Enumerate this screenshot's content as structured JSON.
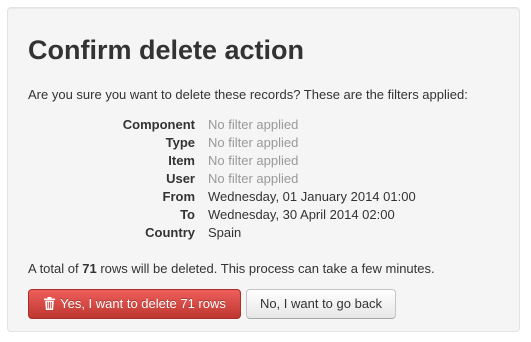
{
  "dialog": {
    "title": "Confirm delete action",
    "intro": "Are you sure you want to delete these records? These are the filters applied:"
  },
  "filters": [
    {
      "label": "Component",
      "value": "No filter applied",
      "applied": false
    },
    {
      "label": "Type",
      "value": "No filter applied",
      "applied": false
    },
    {
      "label": "Item",
      "value": "No filter applied",
      "applied": false
    },
    {
      "label": "User",
      "value": "No filter applied",
      "applied": false
    },
    {
      "label": "From",
      "value": "Wednesday, 01 January 2014 01:00",
      "applied": true
    },
    {
      "label": "To",
      "value": "Wednesday, 30 April 2014 02:00",
      "applied": true
    },
    {
      "label": "Country",
      "value": "Spain",
      "applied": true
    }
  ],
  "summary": {
    "prefix": "A total of",
    "count": "71",
    "suffix": "rows will be deleted. This process can take a few minutes."
  },
  "buttons": {
    "confirm_label": "Yes, I want to delete 71 rows",
    "confirm_icon": "trash-icon",
    "cancel_label": "No, I want to go back"
  },
  "colors": {
    "danger": "#da4f49",
    "muted_text": "#999999",
    "panel_bg": "#f5f5f5"
  }
}
